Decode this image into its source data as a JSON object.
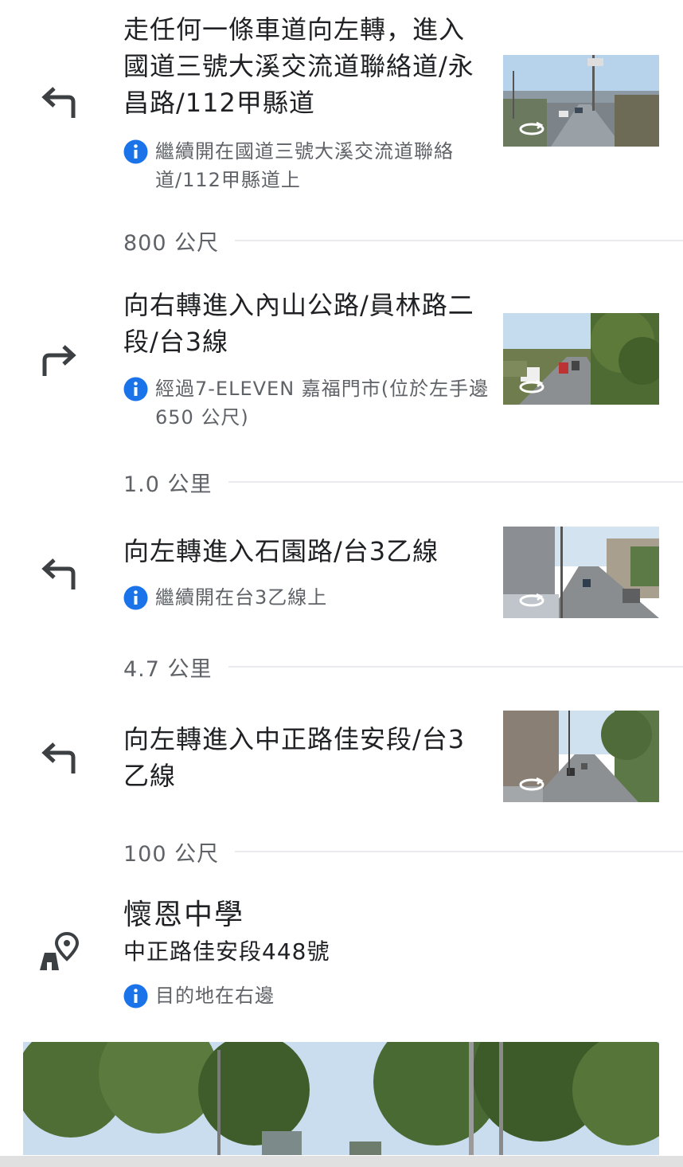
{
  "steps": [
    {
      "icon": "turn-left-icon",
      "title": "走任何一條車道向左轉，進入國道三號大溪交流道聯絡道/永昌路/112甲縣道",
      "note": "繼續開在國道三號大溪交流道聯絡道/112甲縣道上"
    },
    {
      "distance": "800 公尺",
      "icon": "turn-right-icon",
      "title": "向右轉進入內山公路/員林路二段/台3線",
      "note": "經過7-ELEVEN 嘉福門市(位於左手邊 650 公尺)"
    },
    {
      "distance": "1.0 公里",
      "icon": "turn-left-icon",
      "title": "向左轉進入石園路/台3乙線",
      "note": "繼續開在台3乙線上"
    },
    {
      "distance": "4.7 公里",
      "icon": "turn-left-icon",
      "title": "向左轉進入中正路佳安段/台3乙線"
    }
  ],
  "destination": {
    "distance": "100 公尺",
    "icon": "destination-pin-icon",
    "name": "懷恩中學",
    "address": "中正路佳安段448號",
    "note": "目的地在右邊"
  },
  "colors": {
    "info_blue": "#1a73e8",
    "icon_gray": "#3c4043",
    "secondary_text": "#5f6368",
    "divider": "#e8eaed"
  }
}
